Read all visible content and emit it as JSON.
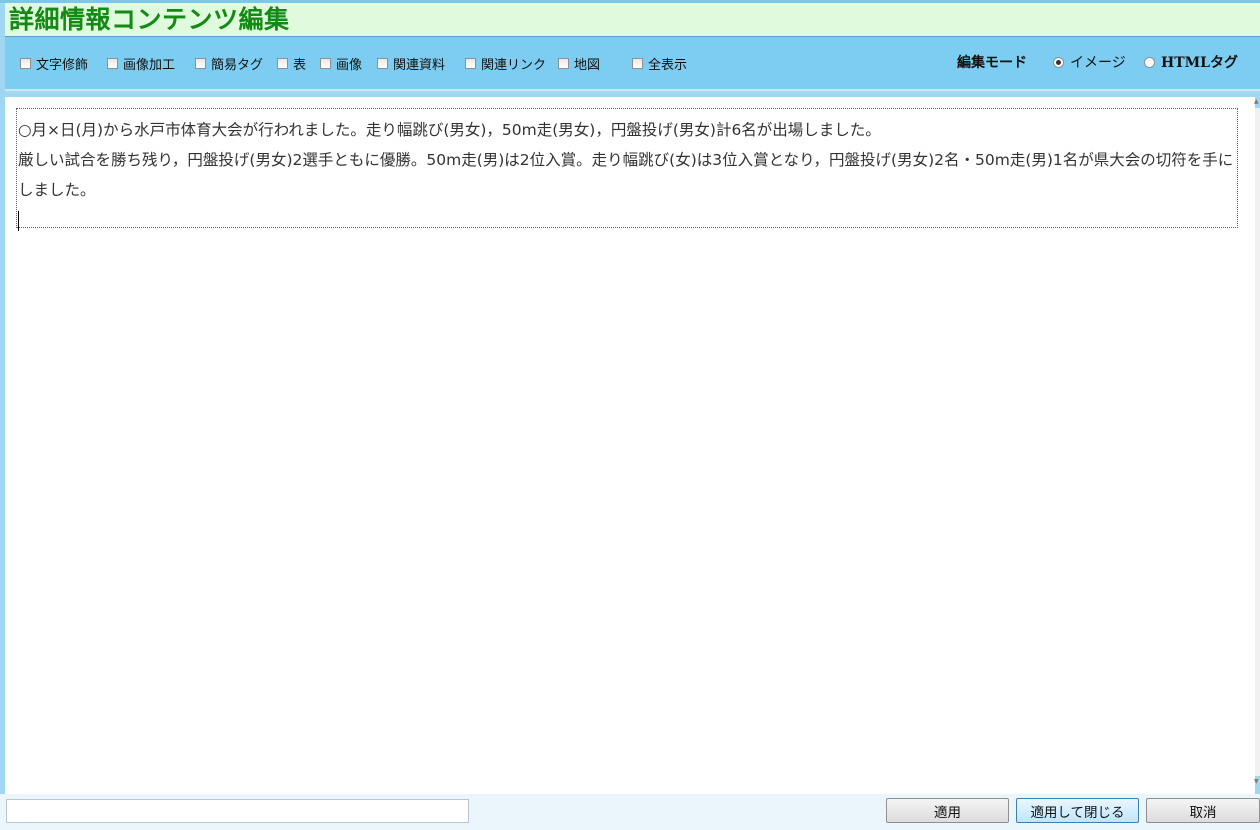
{
  "title": "詳細情報コンテンツ編集",
  "toolbar": {
    "options": [
      {
        "label": "文字修飾",
        "checked": false
      },
      {
        "label": "画像加工",
        "checked": false
      },
      {
        "label": "簡易タグ",
        "checked": false
      },
      {
        "label": "表",
        "checked": false
      },
      {
        "label": "画像",
        "checked": false
      },
      {
        "label": "関連資料",
        "checked": false
      },
      {
        "label": "関連リンク",
        "checked": false
      },
      {
        "label": "地図",
        "checked": false
      },
      {
        "label": "全表示",
        "checked": false
      }
    ],
    "mode_label": "編集モード",
    "modes": [
      {
        "label": "イメージ",
        "selected": true
      },
      {
        "label": "HTMLタグ",
        "selected": false
      }
    ]
  },
  "editor": {
    "paragraphs": [
      "○月×日(月)から水戸市体育大会が行われました。走り幅跳び(男女)，50m走(男女)，円盤投げ(男女)計6名が出場しました。",
      "厳しい試合を勝ち残り，円盤投げ(男女)2選手ともに優勝。50m走(男)は2位入賞。走り幅跳び(女)は3位入賞となり，円盤投げ(男女)2名・50m走(男)1名が県大会の切符を手にしました。"
    ]
  },
  "footer": {
    "status_value": "",
    "apply_label": "適用",
    "apply_close_label": "適用して閉じる",
    "cancel_label": "取消"
  },
  "colors": {
    "title_text": "#138a13",
    "title_bg": "#dffadc",
    "toolbar_bg": "#7ccdf1"
  }
}
